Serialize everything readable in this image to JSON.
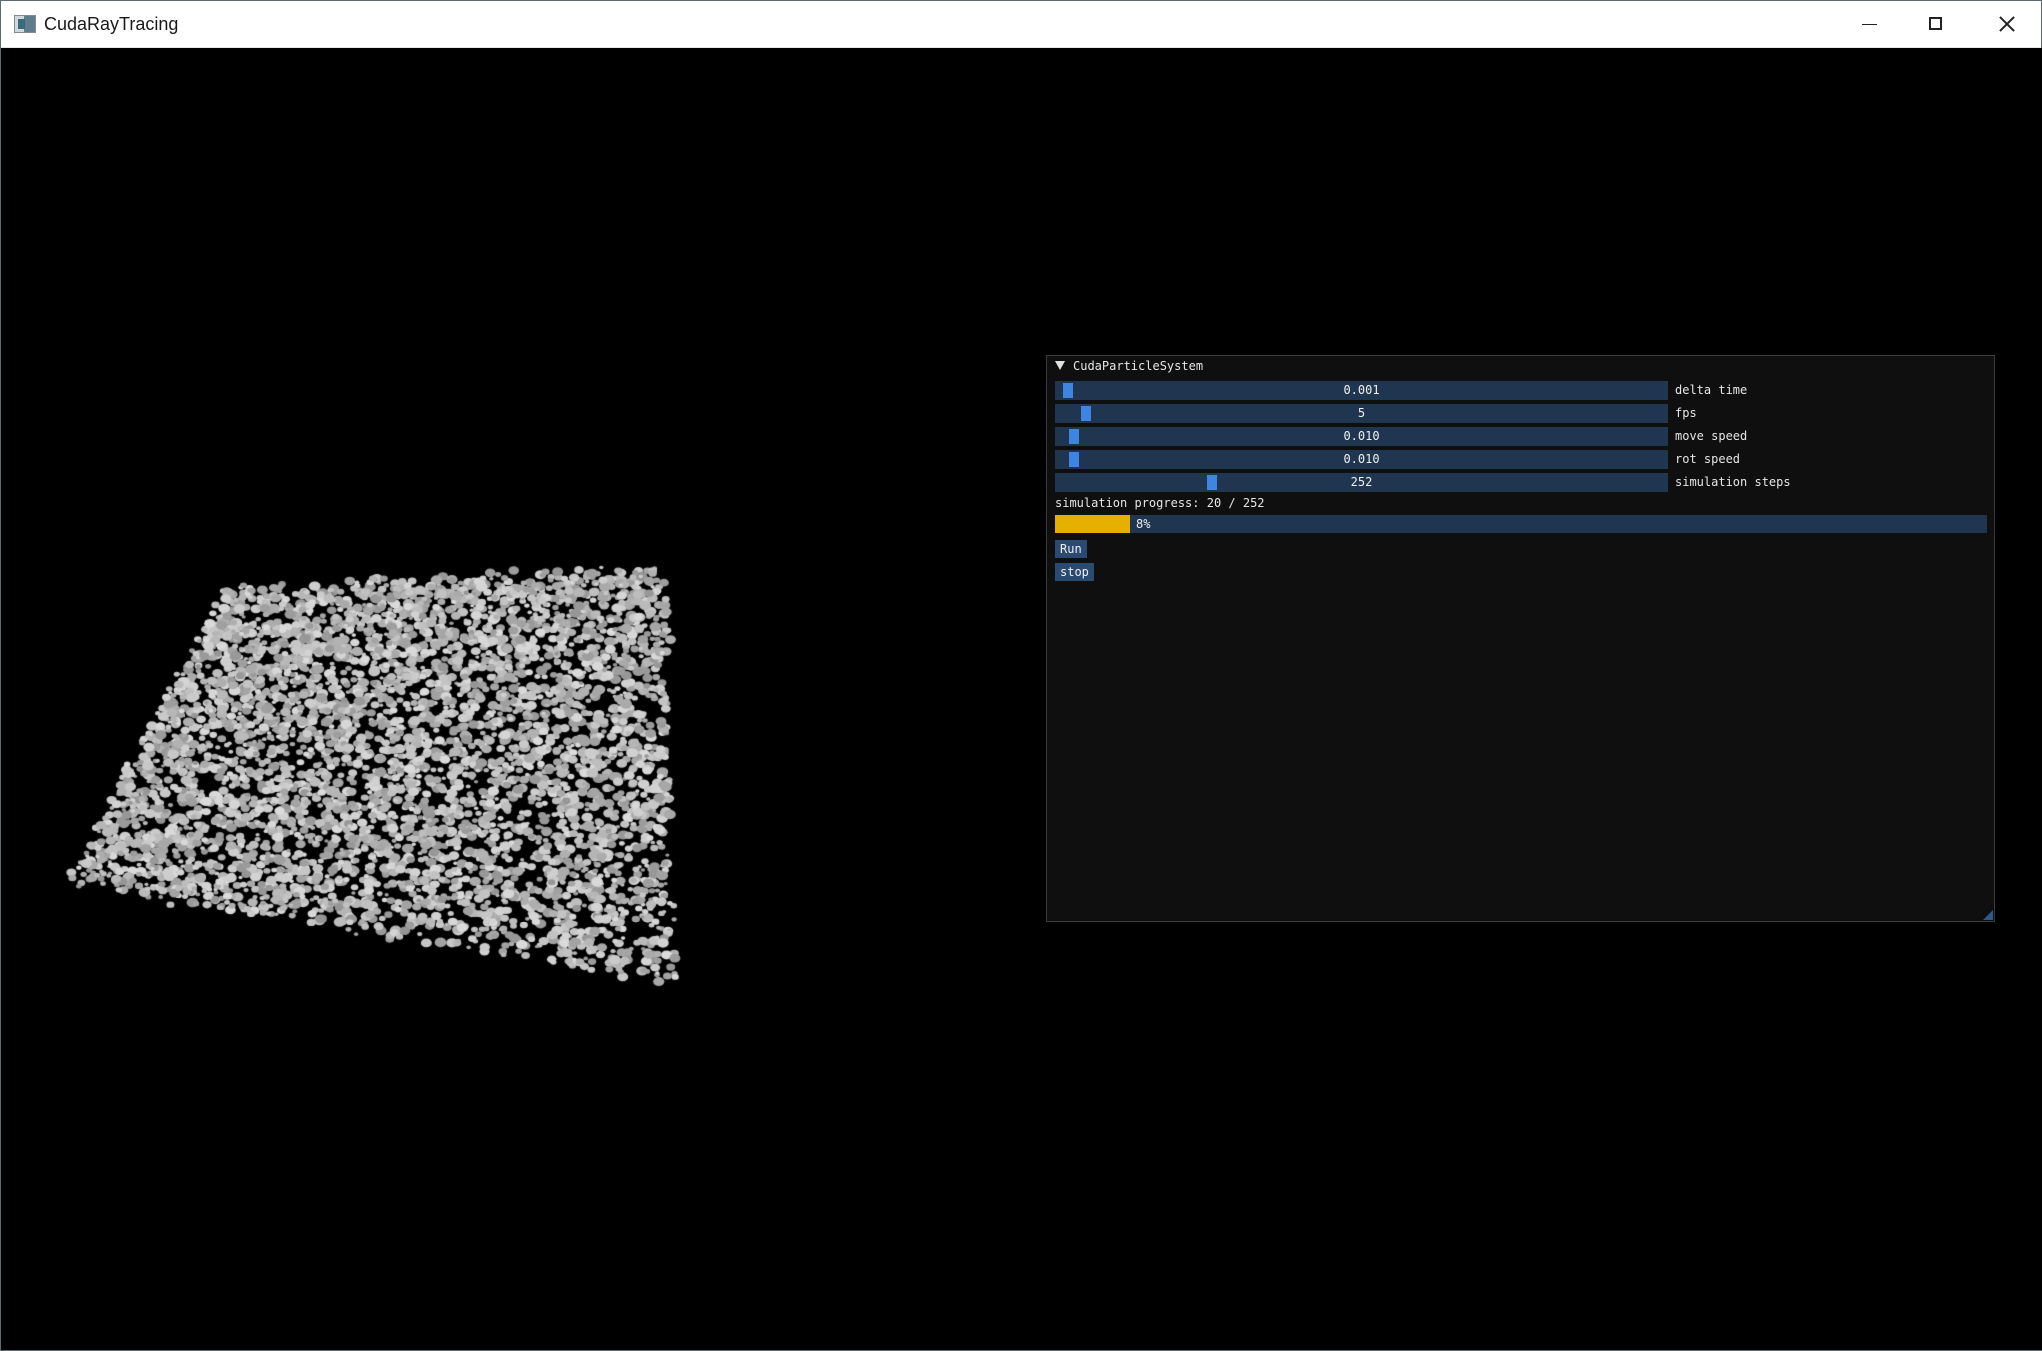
{
  "window": {
    "title": "CudaRayTracing",
    "icon": "app-window-icon",
    "controls": [
      "minimize-icon",
      "maximize-icon",
      "close-icon"
    ]
  },
  "panel": {
    "title": "CudaParticleSystem",
    "collapse_icon": "triangle-down-icon",
    "sliders": [
      {
        "label": "delta time",
        "value": "0.001",
        "fraction": 0.01
      },
      {
        "label": "fps",
        "value": "5",
        "fraction": 0.04
      },
      {
        "label": "move speed",
        "value": "0.010",
        "fraction": 0.02
      },
      {
        "label": "rot speed",
        "value": "0.010",
        "fraction": 0.02
      },
      {
        "label": "simulation steps",
        "value": "252",
        "fraction": 0.25
      }
    ],
    "progress_text": "simulation progress: 20 / 252",
    "progress_fraction": 0.08,
    "progress_label": "8%",
    "buttons": {
      "run": "Run",
      "stop": "stop"
    }
  },
  "colors": {
    "slider_bg": "#1f3550",
    "slider_grab": "#3d85e0",
    "progress_fill": "#e6b000",
    "button_bg": "#2a4a72",
    "particle": "#c8c8c8"
  }
}
